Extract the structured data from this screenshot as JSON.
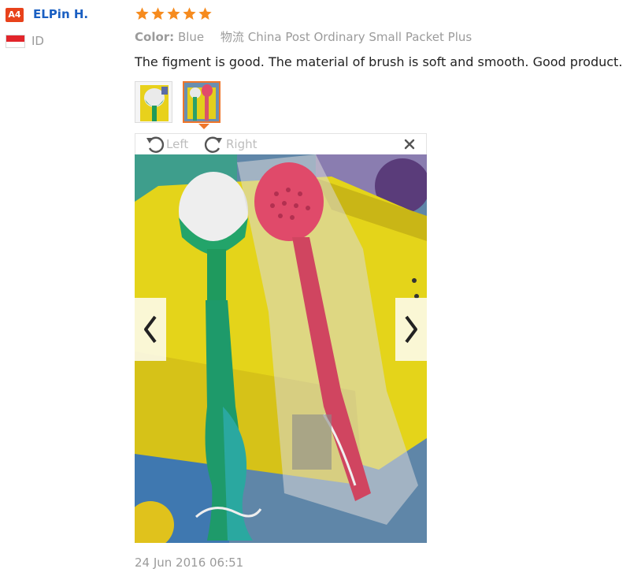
{
  "user": {
    "level_badge": "A4",
    "name": "ELPin H.",
    "country_code": "ID",
    "flag_icon": "flag-icon"
  },
  "review": {
    "rating": 5,
    "rating_max": 5,
    "color_label": "Color:",
    "color_value": "Blue",
    "shipping_label": "物流",
    "shipping_value": "China Post Ordinary Small Packet Plus",
    "text": "The figment is good. The material of brush is soft and smooth. Good product.",
    "date": "24 Jun 2016 06:51"
  },
  "thumbnails": [
    {
      "name": "thumbnail-1",
      "selected": false
    },
    {
      "name": "thumbnail-2",
      "selected": true
    }
  ],
  "viewer": {
    "rotate_left_label": "Left",
    "rotate_right_label": "Right",
    "rotate_left_icon": "rotate-left-icon",
    "rotate_right_icon": "rotate-right-icon",
    "close_icon": "close-icon",
    "prev_icon": "chevron-left-icon",
    "next_icon": "chevron-right-icon"
  },
  "colors": {
    "accent_orange": "#f0762a",
    "star_orange": "#f68b1e",
    "username_blue": "#1a5fc2",
    "badge_red": "#e8421b",
    "muted_gray": "#9b9b9b"
  }
}
